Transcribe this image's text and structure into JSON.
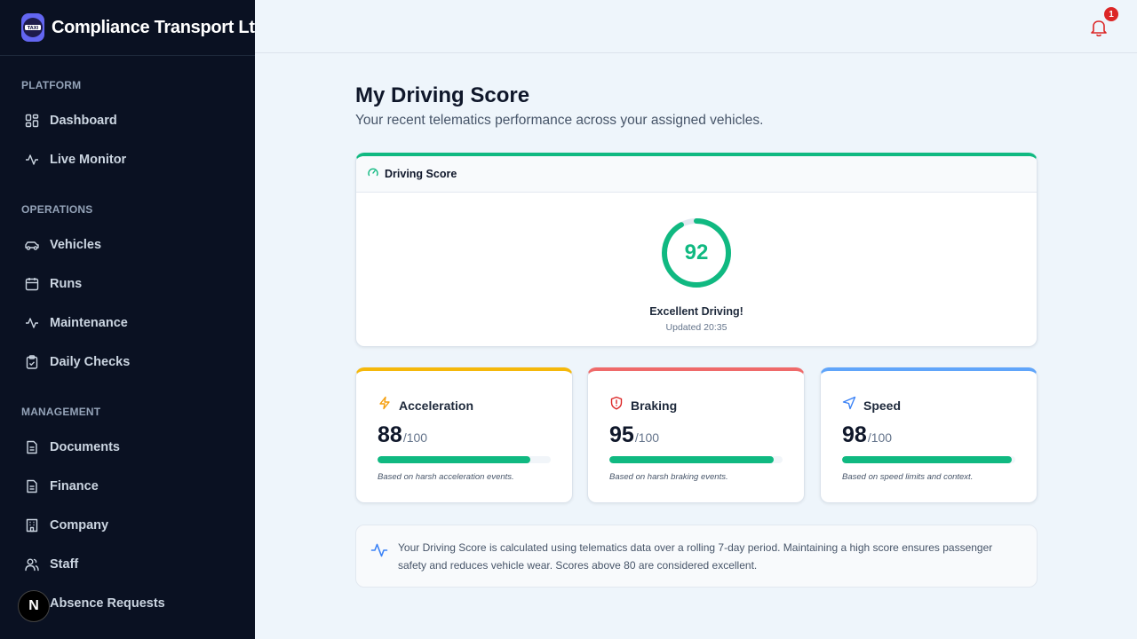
{
  "brand": {
    "name": "Compliance Transport Ltd",
    "logo_text": "TAXI"
  },
  "sidebar": {
    "sections": [
      {
        "label": "PLATFORM",
        "items": [
          {
            "label": "Dashboard",
            "icon": "grid-icon"
          },
          {
            "label": "Live Monitor",
            "icon": "activity-icon"
          }
        ]
      },
      {
        "label": "OPERATIONS",
        "items": [
          {
            "label": "Vehicles",
            "icon": "car-icon"
          },
          {
            "label": "Runs",
            "icon": "calendar-icon"
          },
          {
            "label": "Maintenance",
            "icon": "activity-icon"
          },
          {
            "label": "Daily Checks",
            "icon": "clipboard-check-icon"
          }
        ]
      },
      {
        "label": "MANAGEMENT",
        "items": [
          {
            "label": "Documents",
            "icon": "document-icon"
          },
          {
            "label": "Finance",
            "icon": "document-icon"
          },
          {
            "label": "Company",
            "icon": "building-icon"
          },
          {
            "label": "Staff",
            "icon": "users-icon"
          },
          {
            "label": "Absence Requests",
            "icon": "calendar-icon"
          }
        ]
      }
    ],
    "avatar_letter": "N"
  },
  "header": {
    "notification_count": "1"
  },
  "page": {
    "title": "My Driving Score",
    "subtitle": "Your recent telematics performance across your assigned vehicles."
  },
  "score": {
    "label": "Driving Score",
    "value": "92",
    "max": 100,
    "status": "Excellent Driving!",
    "updated": "Updated 20:35",
    "color": "#10b981"
  },
  "metrics": [
    {
      "title": "Acceleration",
      "value": "88",
      "suffix": "/100",
      "note": "Based on harsh acceleration events.",
      "accent": "#f5b80b",
      "icon": "lightning-icon",
      "fraction": 0.88
    },
    {
      "title": "Braking",
      "value": "95",
      "suffix": "/100",
      "note": "Based on harsh braking events.",
      "accent": "#ef6a6a",
      "icon": "shield-alert-icon",
      "fraction": 0.95
    },
    {
      "title": "Speed",
      "value": "98",
      "suffix": "/100",
      "note": "Based on speed limits and context.",
      "accent": "#60a5fa",
      "icon": "navigation-icon",
      "fraction": 0.98
    }
  ],
  "info": {
    "text": "Your Driving Score is calculated using telematics data over a rolling 7-day period. Maintaining a high score ensures passenger safety and reduces vehicle wear. Scores above 80 are considered excellent."
  }
}
